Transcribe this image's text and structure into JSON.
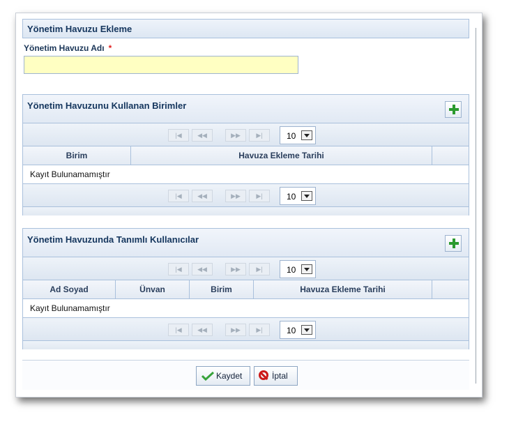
{
  "form": {
    "title": "Yönetim Havuzu Ekleme",
    "pool_name_label": "Yönetim Havuzu Adı",
    "required_mark": "*",
    "pool_name_value": ""
  },
  "units_grid": {
    "title": "Yönetim Havuzunu Kullanan Birimler",
    "columns": [
      "Birim",
      "Havuza Ekleme Tarihi"
    ],
    "empty_text": "Kayıt Bulunamamıştır",
    "page_size": "10"
  },
  "users_grid": {
    "title": "Yönetim Havuzunda Tanımlı Kullanıcılar",
    "columns": [
      "Ad Soyad",
      "Ünvan",
      "Birim",
      "Havuza Ekleme Tarihi"
    ],
    "empty_text": "Kayıt Bulunamamıştır",
    "page_size": "10"
  },
  "pager": {
    "first": "|◀",
    "prev": "◀◀",
    "next": "▶▶",
    "last": "▶|"
  },
  "actions": {
    "save_label": "Kaydet",
    "cancel_label": "İptal"
  },
  "icons": [
    "add-icon",
    "check-icon",
    "cancel-icon",
    "dropdown-arrow-icon"
  ],
  "colors": {
    "header_text": "#15365e",
    "border": "#a9c0dc",
    "input_bg": "#ffffc2",
    "required": "#e02020",
    "add_green": "#2b9a2f",
    "cancel_red": "#cc1a1a"
  }
}
